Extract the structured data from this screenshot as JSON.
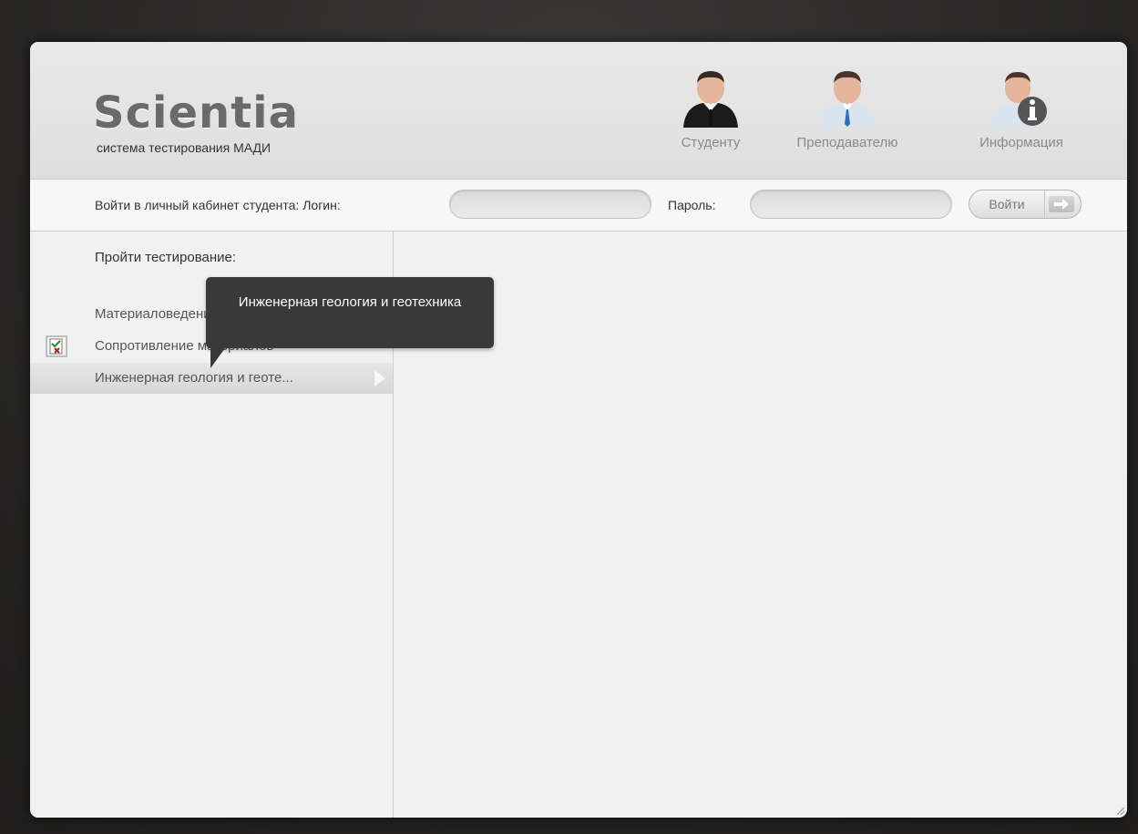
{
  "header": {
    "logo": "Scientia",
    "tagline": "система тестирования МАДИ",
    "nav": [
      {
        "label": "Студенту",
        "icon": "student-icon"
      },
      {
        "label": "Преподавателю",
        "icon": "teacher-icon"
      },
      {
        "label": "Информация",
        "icon": "info-user-icon"
      }
    ]
  },
  "login": {
    "caption": "Войти в личный кабинет студента:",
    "login_label": "Логин:",
    "login_value": "",
    "password_label": "Пароль:",
    "password_value": "",
    "submit_label": "Войти"
  },
  "sidebar": {
    "title": "Пройти тестирование:",
    "items": [
      {
        "label": "Материаловедение",
        "icon": null,
        "active": false
      },
      {
        "label": "Сопротивление материалов",
        "icon": "test-document-icon",
        "active": false
      },
      {
        "label": "Инженерная геология и геоте...",
        "icon": null,
        "active": true
      }
    ]
  },
  "tooltip": {
    "text": "Инженерная геология и геотехника"
  },
  "colors": {
    "background": "#2b2a29",
    "panel": "#f1f1f1",
    "tooltip": "#3a3939",
    "logo": "#6a6a6a"
  }
}
